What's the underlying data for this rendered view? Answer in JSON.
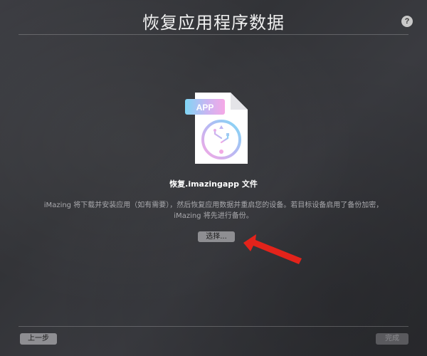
{
  "header": {
    "title": "恢复应用程序数据",
    "help_label": "?"
  },
  "file_icon": {
    "tag": "APP",
    "icon": "imazing-usb-icon"
  },
  "content": {
    "subtitle": "恢复.imazingapp 文件",
    "description_line1": "iMazing 将下载并安装应用（如有需要），然后恢复应用数据并重启您的设备。若目标设备启用了备份加密，",
    "description_line2": "iMazing 将先进行备份。",
    "choose_label": "选择..."
  },
  "footer": {
    "back_label": "上一步",
    "done_label": "完成"
  },
  "colors": {
    "arrow": "#e3231b",
    "tag_gradient_start": "#7fd6f5",
    "tag_gradient_end": "#f6a8e6"
  }
}
